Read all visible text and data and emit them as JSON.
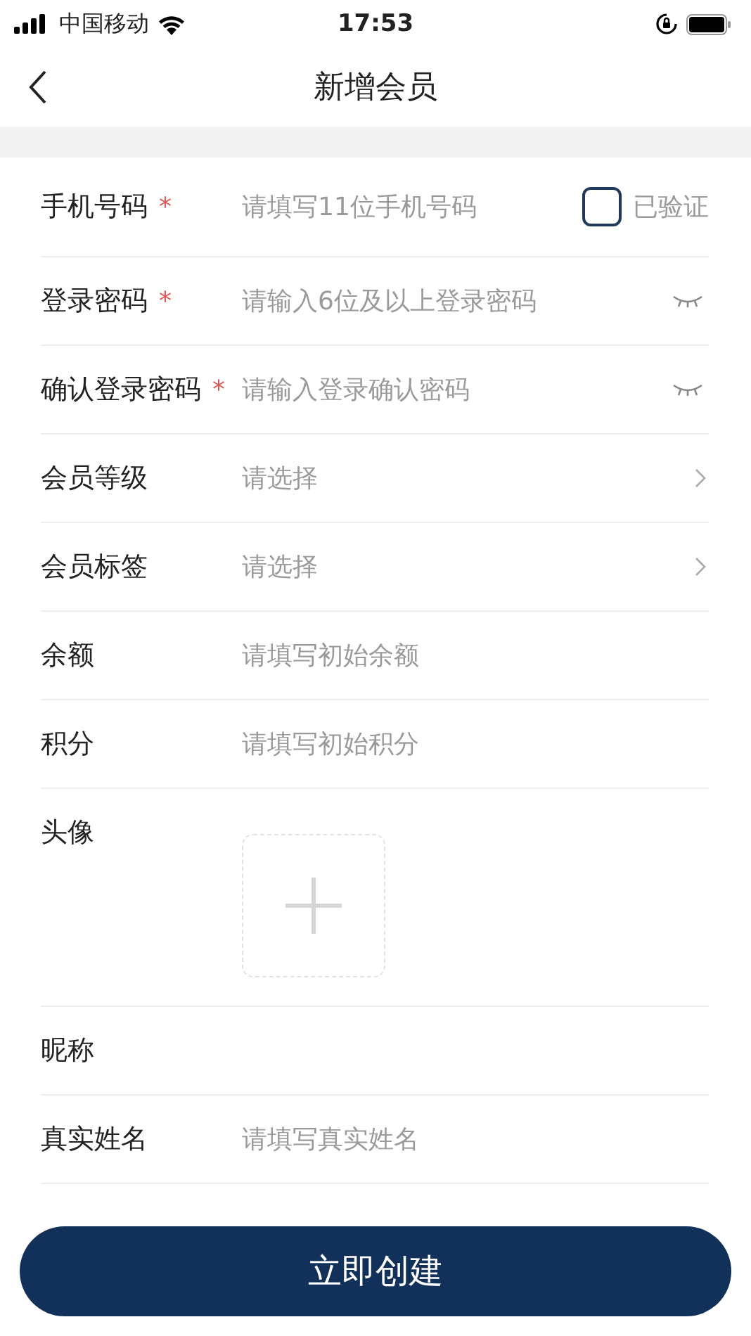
{
  "status_bar": {
    "carrier": "中国移动",
    "time": "17:53"
  },
  "nav": {
    "title": "新增会员"
  },
  "fields": [
    {
      "kind": "text",
      "label": "手机号码",
      "mark": "*",
      "placeholder": "请填写11位手机号码",
      "verify": {
        "label": "已验证",
        "checked": false
      }
    },
    {
      "kind": "password",
      "label": "登录密码",
      "mark": "*",
      "placeholder": "请输入6位及以上登录密码"
    },
    {
      "kind": "password",
      "label": "确认登录密码",
      "mark": "*",
      "placeholder": "请输入登录确认密码"
    },
    {
      "kind": "select",
      "label": "会员等级",
      "placeholder": "请选择"
    },
    {
      "kind": "select",
      "label": "会员标签",
      "placeholder": "请选择"
    },
    {
      "kind": "text",
      "label": "余额",
      "placeholder": "请填写初始余额"
    },
    {
      "kind": "text",
      "label": "积分",
      "placeholder": "请填写初始积分"
    },
    {
      "kind": "avatar",
      "label": "头像"
    },
    {
      "kind": "text",
      "label": "昵称"
    },
    {
      "kind": "text",
      "label": "真实姓名",
      "placeholder": "请填写真实姓名"
    }
  ],
  "submit": "立即创建"
}
